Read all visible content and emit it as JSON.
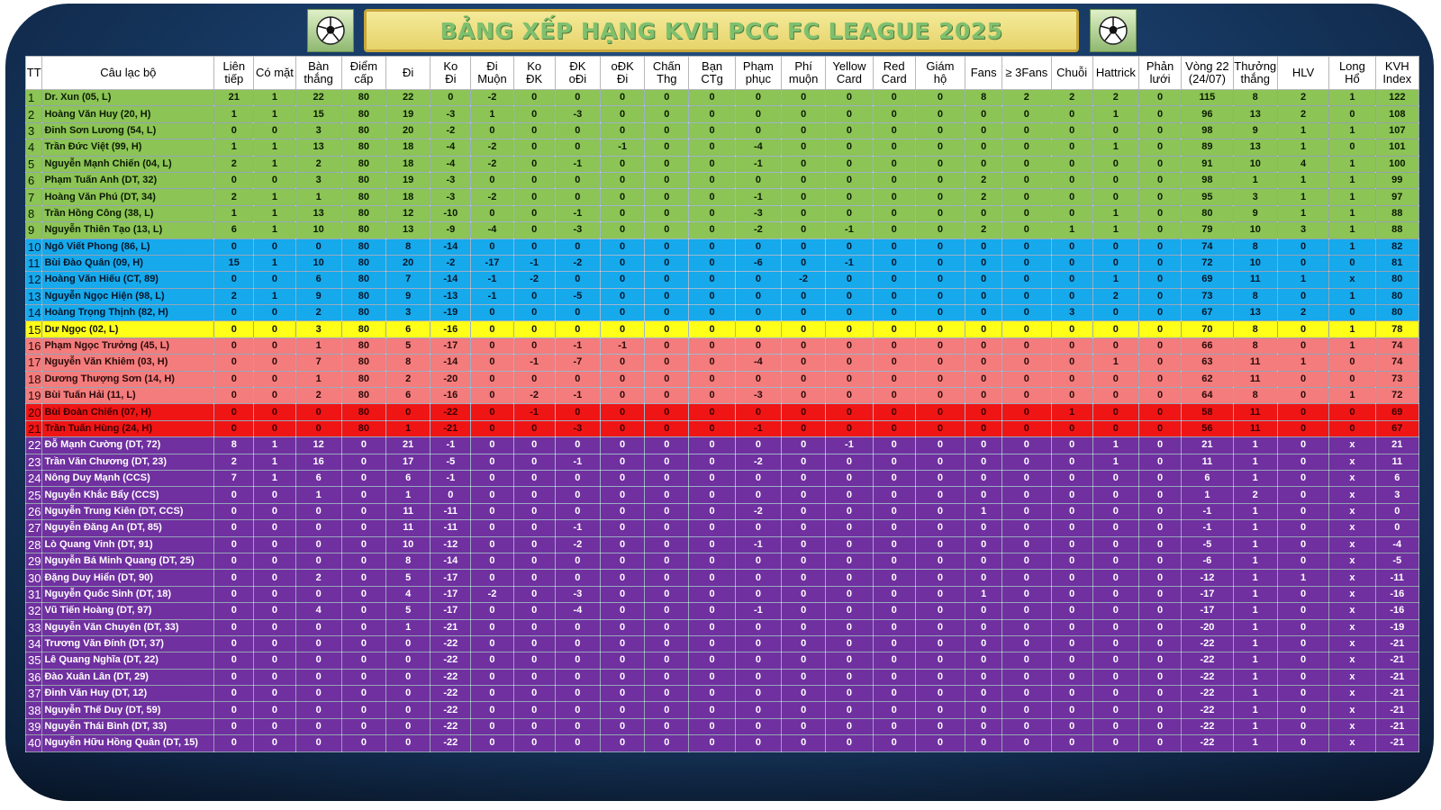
{
  "title": "BẢNG XẾP HẠNG KVH PCC FC LEAGUE 2025",
  "icons": {
    "left": "soccer-ball-icon",
    "right": "soccer-ball-icon"
  },
  "colors": {
    "green": "#8cc455",
    "blue": "#16a9ec",
    "yellow": "#ffff17",
    "salmon": "#f47c7c",
    "red": "#f01515",
    "purple": "#7030a0"
  },
  "headers": [
    "TT",
    "Câu lạc bộ",
    "Liên\ntiếp",
    "Có mặt",
    "Bàn\nthắng",
    "Điểm\ncấp",
    "Đi",
    "Ko\nĐi",
    "Đi\nMuộn",
    "Ko\nĐK",
    "ĐK\noĐi",
    "oĐK\nĐi",
    "Chấn\nThg",
    "Bạn\nCTg",
    "Phạm\nphục",
    "Phí\nmuộn",
    "Yellow\nCard",
    "Red\nCard",
    "Giám\nhộ",
    "Fans",
    "≥ 3Fans",
    "Chuỗi",
    "Hattrick",
    "Phản\nlưới",
    "Vòng 22\n(24/07)",
    "Thưởng\nthắng",
    "HLV",
    "Long\nHổ",
    "KVH\nIndex"
  ],
  "rows": [
    {
      "band": "green",
      "cells": [
        "1",
        "Dr. Xun (05, L)",
        "21",
        "1",
        "22",
        "80",
        "22",
        "0",
        "-2",
        "0",
        "0",
        "0",
        "0",
        "0",
        "0",
        "0",
        "0",
        "0",
        "0",
        "8",
        "2",
        "2",
        "2",
        "0",
        "115",
        "8",
        "2",
        "1",
        "122"
      ]
    },
    {
      "band": "green",
      "cells": [
        "2",
        "Hoàng Văn Huy (20, H)",
        "1",
        "1",
        "15",
        "80",
        "19",
        "-3",
        "1",
        "0",
        "-3",
        "0",
        "0",
        "0",
        "0",
        "0",
        "0",
        "0",
        "0",
        "0",
        "0",
        "0",
        "1",
        "0",
        "96",
        "13",
        "2",
        "0",
        "108"
      ]
    },
    {
      "band": "green",
      "cells": [
        "3",
        "Đinh Sơn Lương (54, L)",
        "0",
        "0",
        "3",
        "80",
        "20",
        "-2",
        "0",
        "0",
        "0",
        "0",
        "0",
        "0",
        "0",
        "0",
        "0",
        "0",
        "0",
        "0",
        "0",
        "0",
        "0",
        "0",
        "98",
        "9",
        "1",
        "1",
        "107"
      ]
    },
    {
      "band": "green",
      "cells": [
        "4",
        "Trần Đức Việt (99, H)",
        "1",
        "1",
        "13",
        "80",
        "18",
        "-4",
        "-2",
        "0",
        "0",
        "-1",
        "0",
        "0",
        "-4",
        "0",
        "0",
        "0",
        "0",
        "0",
        "0",
        "0",
        "1",
        "0",
        "89",
        "13",
        "1",
        "0",
        "101"
      ]
    },
    {
      "band": "green",
      "cells": [
        "5",
        "Nguyễn Mạnh Chiến (04, L)",
        "2",
        "1",
        "2",
        "80",
        "18",
        "-4",
        "-2",
        "0",
        "-1",
        "0",
        "0",
        "0",
        "-1",
        "0",
        "0",
        "0",
        "0",
        "0",
        "0",
        "0",
        "0",
        "0",
        "91",
        "10",
        "4",
        "1",
        "100"
      ]
    },
    {
      "band": "green",
      "cells": [
        "6",
        "Phạm Tuấn Anh (DT, 32)",
        "0",
        "0",
        "3",
        "80",
        "19",
        "-3",
        "0",
        "0",
        "0",
        "0",
        "0",
        "0",
        "0",
        "0",
        "0",
        "0",
        "0",
        "2",
        "0",
        "0",
        "0",
        "0",
        "98",
        "1",
        "1",
        "1",
        "99"
      ]
    },
    {
      "band": "green",
      "cells": [
        "7",
        "Hoàng Văn Phú (DT, 34)",
        "2",
        "1",
        "1",
        "80",
        "18",
        "-3",
        "-2",
        "0",
        "0",
        "0",
        "0",
        "0",
        "-1",
        "0",
        "0",
        "0",
        "0",
        "2",
        "0",
        "0",
        "0",
        "0",
        "95",
        "3",
        "1",
        "1",
        "97"
      ]
    },
    {
      "band": "green",
      "cells": [
        "8",
        "Trần Hồng Công (38, L)",
        "1",
        "1",
        "13",
        "80",
        "12",
        "-10",
        "0",
        "0",
        "-1",
        "0",
        "0",
        "0",
        "-3",
        "0",
        "0",
        "0",
        "0",
        "0",
        "0",
        "0",
        "1",
        "0",
        "80",
        "9",
        "1",
        "1",
        "88"
      ]
    },
    {
      "band": "green",
      "cells": [
        "9",
        "Nguyễn Thiên Tạo (13, L)",
        "6",
        "1",
        "10",
        "80",
        "13",
        "-9",
        "-4",
        "0",
        "-3",
        "0",
        "0",
        "0",
        "-2",
        "0",
        "-1",
        "0",
        "0",
        "2",
        "0",
        "1",
        "1",
        "0",
        "79",
        "10",
        "3",
        "1",
        "88"
      ]
    },
    {
      "band": "blue",
      "cells": [
        "10",
        "Ngô Viết Phong (86, L)",
        "0",
        "0",
        "0",
        "80",
        "8",
        "-14",
        "0",
        "0",
        "0",
        "0",
        "0",
        "0",
        "0",
        "0",
        "0",
        "0",
        "0",
        "0",
        "0",
        "0",
        "0",
        "0",
        "74",
        "8",
        "0",
        "1",
        "82"
      ]
    },
    {
      "band": "blue",
      "cells": [
        "11",
        "Bùi Đào Quân (09, H)",
        "15",
        "1",
        "10",
        "80",
        "20",
        "-2",
        "-17",
        "-1",
        "-2",
        "0",
        "0",
        "0",
        "-6",
        "0",
        "-1",
        "0",
        "0",
        "0",
        "0",
        "0",
        "0",
        "0",
        "72",
        "10",
        "0",
        "0",
        "81"
      ]
    },
    {
      "band": "blue",
      "cells": [
        "12",
        "Hoàng Văn Hiếu (CT, 89)",
        "0",
        "0",
        "6",
        "80",
        "7",
        "-14",
        "-1",
        "-2",
        "0",
        "0",
        "0",
        "0",
        "0",
        "-2",
        "0",
        "0",
        "0",
        "0",
        "0",
        "0",
        "1",
        "0",
        "69",
        "11",
        "1",
        "x",
        "80"
      ]
    },
    {
      "band": "blue",
      "cells": [
        "13",
        "Nguyễn Ngọc Hiện (98, L)",
        "2",
        "1",
        "9",
        "80",
        "9",
        "-13",
        "-1",
        "0",
        "-5",
        "0",
        "0",
        "0",
        "0",
        "0",
        "0",
        "0",
        "0",
        "0",
        "0",
        "0",
        "2",
        "0",
        "73",
        "8",
        "0",
        "1",
        "80"
      ]
    },
    {
      "band": "blue",
      "cells": [
        "14",
        "Hoàng Trọng Thịnh (82, H)",
        "0",
        "0",
        "2",
        "80",
        "3",
        "-19",
        "0",
        "0",
        "0",
        "0",
        "0",
        "0",
        "0",
        "0",
        "0",
        "0",
        "0",
        "0",
        "0",
        "3",
        "0",
        "0",
        "67",
        "13",
        "2",
        "0",
        "80"
      ]
    },
    {
      "band": "yellow",
      "cells": [
        "15",
        "Dư Ngọc (02, L)",
        "0",
        "0",
        "3",
        "80",
        "6",
        "-16",
        "0",
        "0",
        "0",
        "0",
        "0",
        "0",
        "0",
        "0",
        "0",
        "0",
        "0",
        "0",
        "0",
        "0",
        "0",
        "0",
        "70",
        "8",
        "0",
        "1",
        "78"
      ]
    },
    {
      "band": "salmon",
      "cells": [
        "16",
        "Phạm Ngọc Trưởng (45, L)",
        "0",
        "0",
        "1",
        "80",
        "5",
        "-17",
        "0",
        "0",
        "-1",
        "-1",
        "0",
        "0",
        "0",
        "0",
        "0",
        "0",
        "0",
        "0",
        "0",
        "0",
        "0",
        "0",
        "66",
        "8",
        "0",
        "1",
        "74"
      ]
    },
    {
      "band": "salmon",
      "cells": [
        "17",
        "Nguyễn Văn Khiêm (03, H)",
        "0",
        "0",
        "7",
        "80",
        "8",
        "-14",
        "0",
        "-1",
        "-7",
        "0",
        "0",
        "0",
        "-4",
        "0",
        "0",
        "0",
        "0",
        "0",
        "0",
        "0",
        "1",
        "0",
        "63",
        "11",
        "1",
        "0",
        "74"
      ]
    },
    {
      "band": "salmon",
      "cells": [
        "18",
        "Dương Thượng Sơn (14, H)",
        "0",
        "0",
        "1",
        "80",
        "2",
        "-20",
        "0",
        "0",
        "0",
        "0",
        "0",
        "0",
        "0",
        "0",
        "0",
        "0",
        "0",
        "0",
        "0",
        "0",
        "0",
        "0",
        "62",
        "11",
        "0",
        "0",
        "73"
      ]
    },
    {
      "band": "salmon",
      "cells": [
        "19",
        "Bùi Tuấn Hải (11, L)",
        "0",
        "0",
        "2",
        "80",
        "6",
        "-16",
        "0",
        "-2",
        "-1",
        "0",
        "0",
        "0",
        "-3",
        "0",
        "0",
        "0",
        "0",
        "0",
        "0",
        "0",
        "0",
        "0",
        "64",
        "8",
        "0",
        "1",
        "72"
      ]
    },
    {
      "band": "red",
      "cells": [
        "20",
        "Bùi Đoàn Chiến (07, H)",
        "0",
        "0",
        "0",
        "80",
        "0",
        "-22",
        "0",
        "-1",
        "0",
        "0",
        "0",
        "0",
        "0",
        "0",
        "0",
        "0",
        "0",
        "0",
        "0",
        "1",
        "0",
        "0",
        "58",
        "11",
        "0",
        "0",
        "69"
      ]
    },
    {
      "band": "red",
      "cells": [
        "21",
        "Trần Tuấn Hùng (24, H)",
        "0",
        "0",
        "0",
        "80",
        "1",
        "-21",
        "0",
        "0",
        "-3",
        "0",
        "0",
        "0",
        "-1",
        "0",
        "0",
        "0",
        "0",
        "0",
        "0",
        "0",
        "0",
        "0",
        "56",
        "11",
        "0",
        "0",
        "67"
      ]
    },
    {
      "band": "purple",
      "cells": [
        "22",
        "Đỗ Mạnh Cường (DT, 72)",
        "8",
        "1",
        "12",
        "0",
        "21",
        "-1",
        "0",
        "0",
        "0",
        "0",
        "0",
        "0",
        "0",
        "0",
        "-1",
        "0",
        "0",
        "0",
        "0",
        "0",
        "1",
        "0",
        "21",
        "1",
        "0",
        "x",
        "21"
      ]
    },
    {
      "band": "purple",
      "cells": [
        "23",
        "Trần Văn Chương (DT, 23)",
        "2",
        "1",
        "16",
        "0",
        "17",
        "-5",
        "0",
        "0",
        "-1",
        "0",
        "0",
        "0",
        "-2",
        "0",
        "0",
        "0",
        "0",
        "0",
        "0",
        "0",
        "1",
        "0",
        "11",
        "1",
        "0",
        "x",
        "11"
      ]
    },
    {
      "band": "purple",
      "cells": [
        "24",
        "Nông Duy Mạnh (CCS)",
        "7",
        "1",
        "6",
        "0",
        "6",
        "-1",
        "0",
        "0",
        "0",
        "0",
        "0",
        "0",
        "0",
        "0",
        "0",
        "0",
        "0",
        "0",
        "0",
        "0",
        "0",
        "0",
        "6",
        "1",
        "0",
        "x",
        "6"
      ]
    },
    {
      "band": "purple",
      "cells": [
        "25",
        "Nguyễn Khắc Bẩy (CCS)",
        "0",
        "0",
        "1",
        "0",
        "1",
        "0",
        "0",
        "0",
        "0",
        "0",
        "0",
        "0",
        "0",
        "0",
        "0",
        "0",
        "0",
        "0",
        "0",
        "0",
        "0",
        "0",
        "1",
        "2",
        "0",
        "x",
        "3"
      ]
    },
    {
      "band": "purple",
      "cells": [
        "26",
        "Nguyễn Trung Kiên (DT, CCS)",
        "0",
        "0",
        "0",
        "0",
        "11",
        "-11",
        "0",
        "0",
        "0",
        "0",
        "0",
        "0",
        "-2",
        "0",
        "0",
        "0",
        "0",
        "1",
        "0",
        "0",
        "0",
        "0",
        "-1",
        "1",
        "0",
        "x",
        "0"
      ]
    },
    {
      "band": "purple",
      "cells": [
        "27",
        "Nguyễn Đăng An (DT, 85)",
        "0",
        "0",
        "0",
        "0",
        "11",
        "-11",
        "0",
        "0",
        "-1",
        "0",
        "0",
        "0",
        "0",
        "0",
        "0",
        "0",
        "0",
        "0",
        "0",
        "0",
        "0",
        "0",
        "-1",
        "1",
        "0",
        "x",
        "0"
      ]
    },
    {
      "band": "purple",
      "cells": [
        "28",
        "Lò Quang Vinh (DT, 91)",
        "0",
        "0",
        "0",
        "0",
        "10",
        "-12",
        "0",
        "0",
        "-2",
        "0",
        "0",
        "0",
        "-1",
        "0",
        "0",
        "0",
        "0",
        "0",
        "0",
        "0",
        "0",
        "0",
        "-5",
        "1",
        "0",
        "x",
        "-4"
      ]
    },
    {
      "band": "purple",
      "cells": [
        "29",
        "Nguyễn Bá Minh Quang (DT, 25)",
        "0",
        "0",
        "0",
        "0",
        "8",
        "-14",
        "0",
        "0",
        "0",
        "0",
        "0",
        "0",
        "0",
        "0",
        "0",
        "0",
        "0",
        "0",
        "0",
        "0",
        "0",
        "0",
        "-6",
        "1",
        "0",
        "x",
        "-5"
      ]
    },
    {
      "band": "purple",
      "cells": [
        "30",
        "Đặng Duy Hiển (DT, 90)",
        "0",
        "0",
        "2",
        "0",
        "5",
        "-17",
        "0",
        "0",
        "0",
        "0",
        "0",
        "0",
        "0",
        "0",
        "0",
        "0",
        "0",
        "0",
        "0",
        "0",
        "0",
        "0",
        "-12",
        "1",
        "1",
        "x",
        "-11"
      ]
    },
    {
      "band": "purple",
      "cells": [
        "31",
        "Nguyễn Quốc Sinh (DT, 18)",
        "0",
        "0",
        "0",
        "0",
        "4",
        "-17",
        "-2",
        "0",
        "-3",
        "0",
        "0",
        "0",
        "0",
        "0",
        "0",
        "0",
        "0",
        "1",
        "0",
        "0",
        "0",
        "0",
        "-17",
        "1",
        "0",
        "x",
        "-16"
      ]
    },
    {
      "band": "purple",
      "cells": [
        "32",
        "Vũ Tiến Hoàng (DT, 97)",
        "0",
        "0",
        "4",
        "0",
        "5",
        "-17",
        "0",
        "0",
        "-4",
        "0",
        "0",
        "0",
        "-1",
        "0",
        "0",
        "0",
        "0",
        "0",
        "0",
        "0",
        "0",
        "0",
        "-17",
        "1",
        "0",
        "x",
        "-16"
      ]
    },
    {
      "band": "purple",
      "cells": [
        "33",
        "Nguyễn Văn Chuyên (DT, 33)",
        "0",
        "0",
        "0",
        "0",
        "1",
        "-21",
        "0",
        "0",
        "0",
        "0",
        "0",
        "0",
        "0",
        "0",
        "0",
        "0",
        "0",
        "0",
        "0",
        "0",
        "0",
        "0",
        "-20",
        "1",
        "0",
        "x",
        "-19"
      ]
    },
    {
      "band": "purple",
      "cells": [
        "34",
        "Trương Văn Đính (DT, 37)",
        "0",
        "0",
        "0",
        "0",
        "0",
        "-22",
        "0",
        "0",
        "0",
        "0",
        "0",
        "0",
        "0",
        "0",
        "0",
        "0",
        "0",
        "0",
        "0",
        "0",
        "0",
        "0",
        "-22",
        "1",
        "0",
        "x",
        "-21"
      ]
    },
    {
      "band": "purple",
      "cells": [
        "35",
        "Lê Quang Nghĩa (DT, 22)",
        "0",
        "0",
        "0",
        "0",
        "0",
        "-22",
        "0",
        "0",
        "0",
        "0",
        "0",
        "0",
        "0",
        "0",
        "0",
        "0",
        "0",
        "0",
        "0",
        "0",
        "0",
        "0",
        "-22",
        "1",
        "0",
        "x",
        "-21"
      ]
    },
    {
      "band": "purple",
      "cells": [
        "36",
        "Đào Xuân Lân (DT, 29)",
        "0",
        "0",
        "0",
        "0",
        "0",
        "-22",
        "0",
        "0",
        "0",
        "0",
        "0",
        "0",
        "0",
        "0",
        "0",
        "0",
        "0",
        "0",
        "0",
        "0",
        "0",
        "0",
        "-22",
        "1",
        "0",
        "x",
        "-21"
      ]
    },
    {
      "band": "purple",
      "cells": [
        "37",
        "Đinh Văn Huy (DT, 12)",
        "0",
        "0",
        "0",
        "0",
        "0",
        "-22",
        "0",
        "0",
        "0",
        "0",
        "0",
        "0",
        "0",
        "0",
        "0",
        "0",
        "0",
        "0",
        "0",
        "0",
        "0",
        "0",
        "-22",
        "1",
        "0",
        "x",
        "-21"
      ]
    },
    {
      "band": "purple",
      "cells": [
        "38",
        "Nguyễn Thế Duy (DT, 59)",
        "0",
        "0",
        "0",
        "0",
        "0",
        "-22",
        "0",
        "0",
        "0",
        "0",
        "0",
        "0",
        "0",
        "0",
        "0",
        "0",
        "0",
        "0",
        "0",
        "0",
        "0",
        "0",
        "-22",
        "1",
        "0",
        "x",
        "-21"
      ]
    },
    {
      "band": "purple",
      "cells": [
        "39",
        "Nguyễn Thái Bình (DT, 33)",
        "0",
        "0",
        "0",
        "0",
        "0",
        "-22",
        "0",
        "0",
        "0",
        "0",
        "0",
        "0",
        "0",
        "0",
        "0",
        "0",
        "0",
        "0",
        "0",
        "0",
        "0",
        "0",
        "-22",
        "1",
        "0",
        "x",
        "-21"
      ]
    },
    {
      "band": "purple",
      "cells": [
        "40",
        "Nguyễn Hữu Hồng Quân (DT, 15)",
        "0",
        "0",
        "0",
        "0",
        "0",
        "-22",
        "0",
        "0",
        "0",
        "0",
        "0",
        "0",
        "0",
        "0",
        "0",
        "0",
        "0",
        "0",
        "0",
        "0",
        "0",
        "0",
        "-22",
        "1",
        "0",
        "x",
        "-21"
      ]
    }
  ]
}
